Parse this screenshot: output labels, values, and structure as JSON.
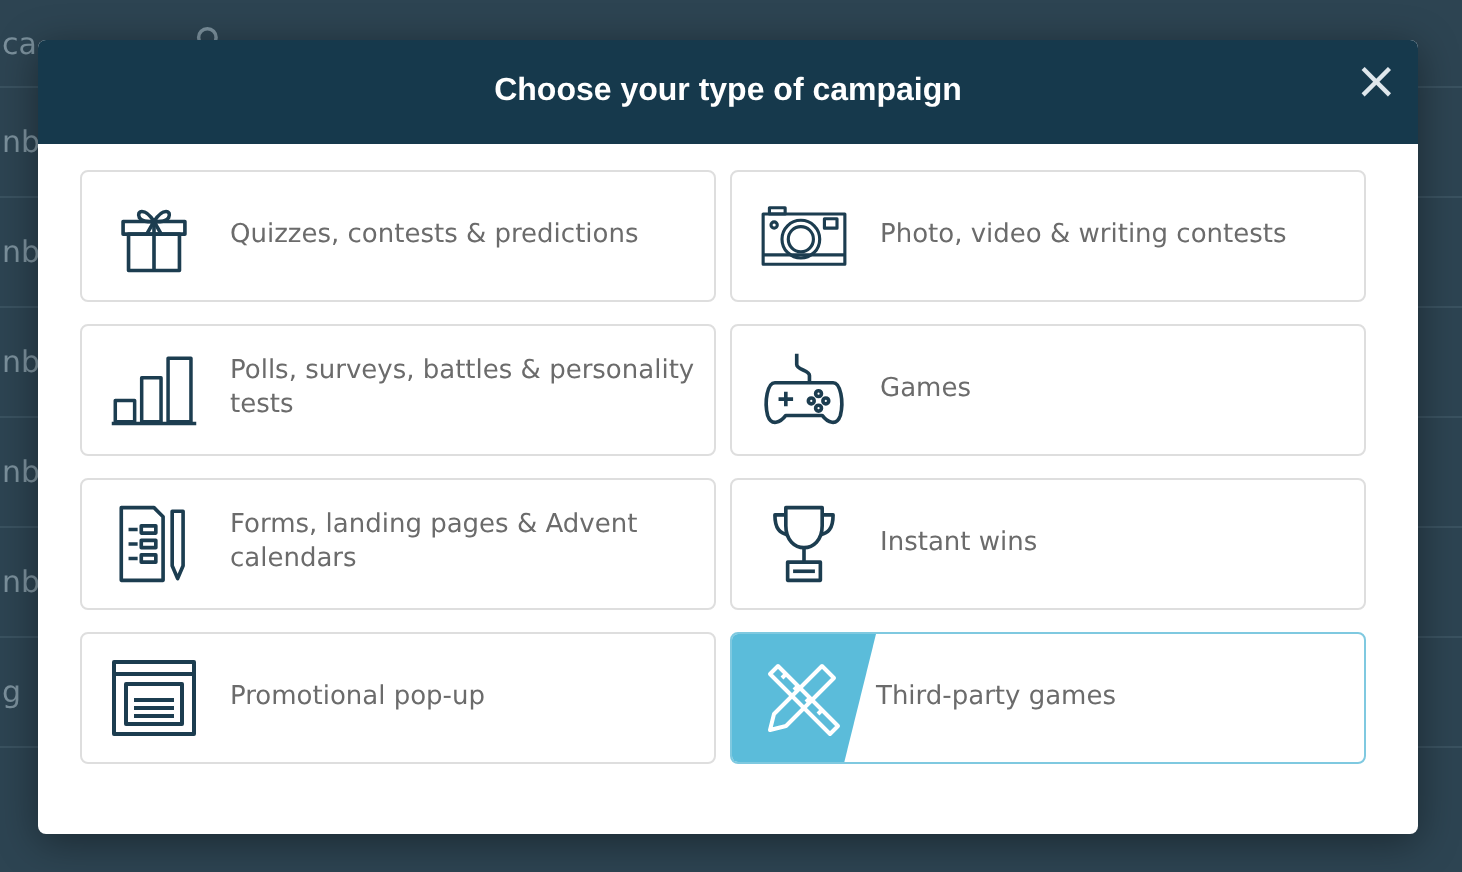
{
  "background": {
    "header_text": "ca",
    "rows": [
      "nb",
      "nb",
      "nb",
      "nb",
      "nb",
      "g"
    ]
  },
  "dialog": {
    "title": "Choose your type of campaign",
    "close": "×",
    "options": [
      {
        "label": "Quizzes, contests & predictions",
        "selected": false
      },
      {
        "label": "Photo, video & writing contests",
        "selected": false
      },
      {
        "label": "Polls, surveys, battles & personality tests",
        "selected": false
      },
      {
        "label": "Games",
        "selected": false
      },
      {
        "label": "Forms, landing pages & Advent calendars",
        "selected": false
      },
      {
        "label": "Instant wins",
        "selected": false
      },
      {
        "label": "Promotional pop-up",
        "selected": false
      },
      {
        "label": "Third-party games",
        "selected": true
      }
    ]
  }
}
